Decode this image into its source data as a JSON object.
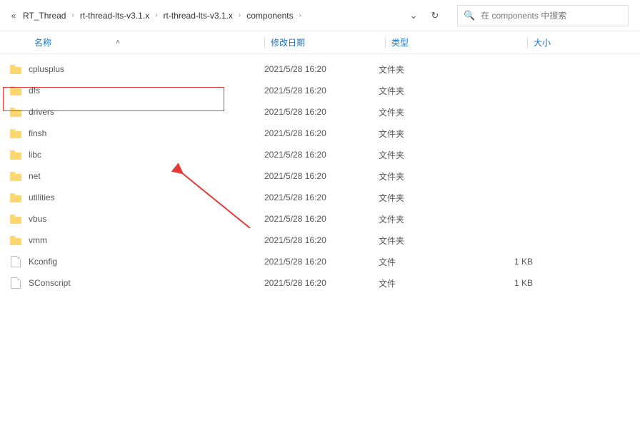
{
  "breadcrumb": {
    "items": [
      "RT_Thread",
      "rt-thread-lts-v3.1.x",
      "rt-thread-lts-v3.1.x",
      "components"
    ]
  },
  "search": {
    "placeholder": "在 components 中搜索"
  },
  "cols": {
    "name": "名称",
    "date": "修改日期",
    "type": "类型",
    "size": "大小"
  },
  "files": [
    {
      "name": "cplusplus",
      "date": "2021/5/28 16:20",
      "type": "文件夹",
      "size": "",
      "kind": "folder"
    },
    {
      "name": "dfs",
      "date": "2021/5/28 16:20",
      "type": "文件夹",
      "size": "",
      "kind": "folder"
    },
    {
      "name": "drivers",
      "date": "2021/5/28 16:20",
      "type": "文件夹",
      "size": "",
      "kind": "folder"
    },
    {
      "name": "finsh",
      "date": "2021/5/28 16:20",
      "type": "文件夹",
      "size": "",
      "kind": "folder"
    },
    {
      "name": "libc",
      "date": "2021/5/28 16:20",
      "type": "文件夹",
      "size": "",
      "kind": "folder"
    },
    {
      "name": "net",
      "date": "2021/5/28 16:20",
      "type": "文件夹",
      "size": "",
      "kind": "folder"
    },
    {
      "name": "utilities",
      "date": "2021/5/28 16:20",
      "type": "文件夹",
      "size": "",
      "kind": "folder"
    },
    {
      "name": "vbus",
      "date": "2021/5/28 16:20",
      "type": "文件夹",
      "size": "",
      "kind": "folder"
    },
    {
      "name": "vmm",
      "date": "2021/5/28 16:20",
      "type": "文件夹",
      "size": "",
      "kind": "folder"
    },
    {
      "name": "Kconfig",
      "date": "2021/5/28 16:20",
      "type": "文件",
      "size": "1 KB",
      "kind": "file"
    },
    {
      "name": "SConscript",
      "date": "2021/5/28 16:20",
      "type": "文件",
      "size": "1 KB",
      "kind": "file"
    }
  ]
}
